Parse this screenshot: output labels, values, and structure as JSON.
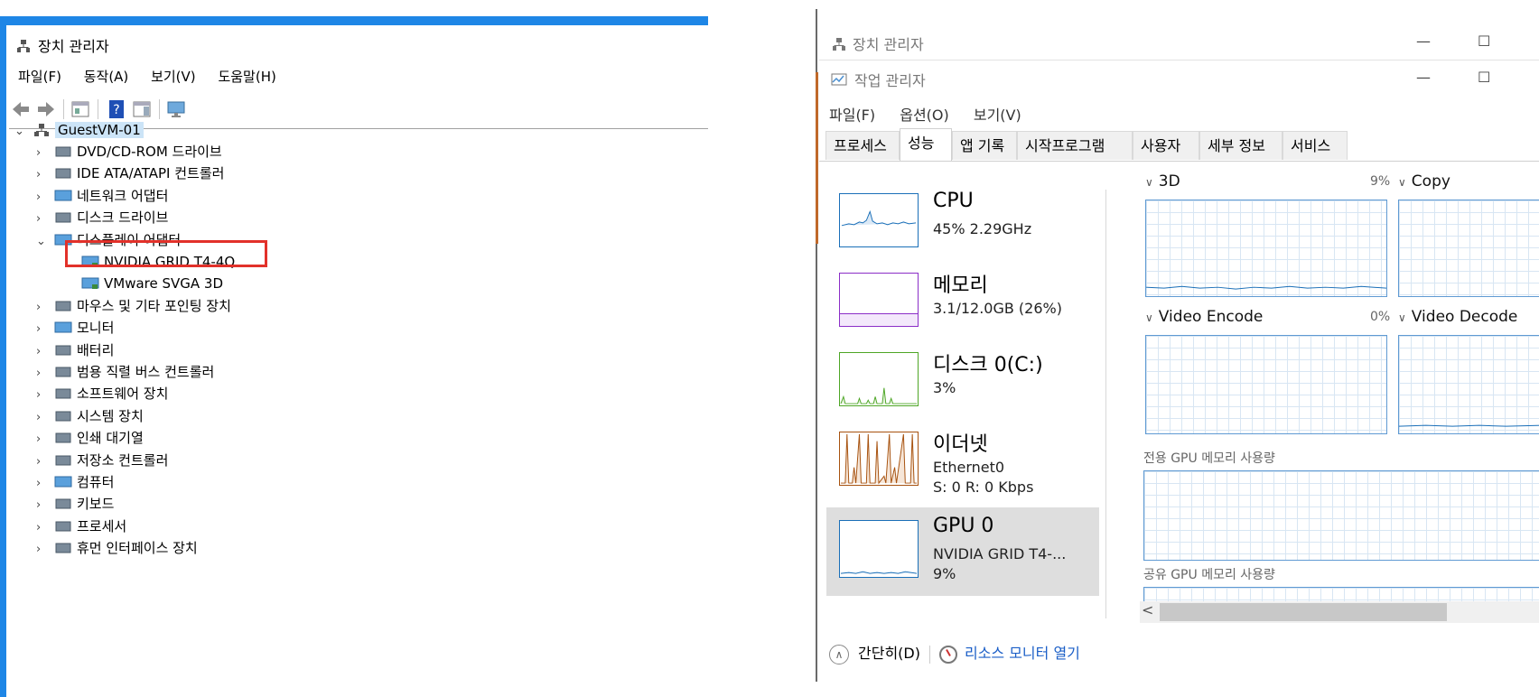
{
  "device_manager": {
    "title": "장치 관리자",
    "menu": [
      "파일(F)",
      "동작(A)",
      "보기(V)",
      "도움말(H)"
    ],
    "root": "GuestVM-01",
    "items": [
      {
        "label": "DVD/CD-ROM 드라이브",
        "icon": "dvd-drive-icon"
      },
      {
        "label": "IDE ATA/ATAPI 컨트롤러",
        "icon": "ide-controller-icon"
      },
      {
        "label": "네트워크 어댑터",
        "icon": "network-adapter-icon"
      },
      {
        "label": "디스크 드라이브",
        "icon": "disk-drive-icon"
      },
      {
        "label": "디스플레이 어댑터",
        "icon": "display-adapter-icon",
        "expanded": true,
        "children": [
          "NVIDIA GRID T4-4Q",
          "VMware SVGA 3D"
        ]
      },
      {
        "label": "마우스 및 기타 포인팅 장치",
        "icon": "mouse-icon"
      },
      {
        "label": "모니터",
        "icon": "monitor-icon"
      },
      {
        "label": "배터리",
        "icon": "battery-icon"
      },
      {
        "label": "범용 직렬 버스 컨트롤러",
        "icon": "usb-icon"
      },
      {
        "label": "소프트웨어 장치",
        "icon": "software-device-icon"
      },
      {
        "label": "시스템 장치",
        "icon": "system-device-icon"
      },
      {
        "label": "인쇄 대기열",
        "icon": "printer-icon"
      },
      {
        "label": "저장소 컨트롤러",
        "icon": "storage-controller-icon"
      },
      {
        "label": "컴퓨터",
        "icon": "computer-icon"
      },
      {
        "label": "키보드",
        "icon": "keyboard-icon"
      },
      {
        "label": "프로세서",
        "icon": "processor-icon"
      },
      {
        "label": "휴먼 인터페이스 장치",
        "icon": "hid-icon"
      }
    ],
    "highlight_color": "#e2312a"
  },
  "background_window": {
    "title": "장치 관리자",
    "minimize": "—",
    "maximize": "☐"
  },
  "task_manager": {
    "title": "작업 관리자",
    "minimize": "—",
    "maximize": "☐",
    "menu": [
      "파일(F)",
      "옵션(O)",
      "보기(V)"
    ],
    "tabs": [
      "프로세스",
      "성능",
      "앱 기록",
      "시작프로그램",
      "사용자",
      "세부 정보",
      "서비스"
    ],
    "active_tab": "성능",
    "sidebar": [
      {
        "name": "CPU",
        "line1": "45% 2.29GHz",
        "line2": "",
        "color": "#1a6fb8"
      },
      {
        "name": "메모리",
        "line1": "3.1/12.0GB (26%)",
        "line2": "",
        "color": "#8b2ec7"
      },
      {
        "name": "디스크 0(C:)",
        "line1": "3%",
        "line2": "",
        "color": "#4ea626"
      },
      {
        "name": "이더넷",
        "line1": "Ethernet0",
        "line2": "S: 0 R: 0 Kbps",
        "color": "#a7520f"
      },
      {
        "name": "GPU 0",
        "line1": "NVIDIA GRID T4-...",
        "line2": "9%",
        "color": "#1a6fb8"
      }
    ],
    "engines": [
      {
        "name": "3D",
        "pct": "9%"
      },
      {
        "name": "Copy",
        "pct": ""
      },
      {
        "name": "Video Encode",
        "pct": "0%"
      },
      {
        "name": "Video Decode",
        "pct": ""
      }
    ],
    "dedicated_label": "전용 GPU 메모리 사용량",
    "shared_label": "공유 GPU 메모리 사용량",
    "scroll_left": "<",
    "collapse_label": "간단히(D)",
    "resource_monitor_label": "리소스 모니터 열기"
  }
}
